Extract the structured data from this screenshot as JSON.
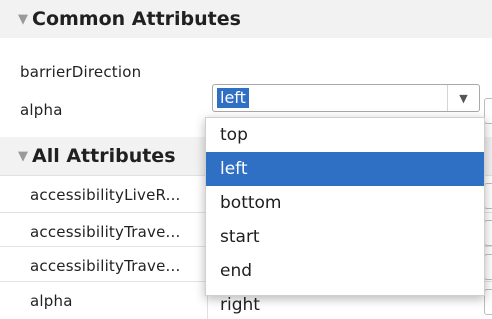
{
  "common": {
    "header": "Common Attributes",
    "rows": [
      {
        "label": "barrierDirection"
      },
      {
        "label": "alpha"
      }
    ]
  },
  "combo": {
    "value": "left",
    "options": [
      "top",
      "left",
      "bottom",
      "start",
      "end",
      "right"
    ],
    "selected_index": 1
  },
  "all": {
    "header": "All Attributes",
    "rows": [
      {
        "label": "accessibilityLiveR..."
      },
      {
        "label": "accessibilityTrave..."
      },
      {
        "label": "accessibilityTrave..."
      },
      {
        "label": "alpha"
      }
    ]
  },
  "colors": {
    "selection": "#2f6fc4",
    "header_bg": "#f2f2f2"
  },
  "icons": {
    "collapse": "triangle-down-icon",
    "combo_arrow": "chevron-down-icon"
  }
}
